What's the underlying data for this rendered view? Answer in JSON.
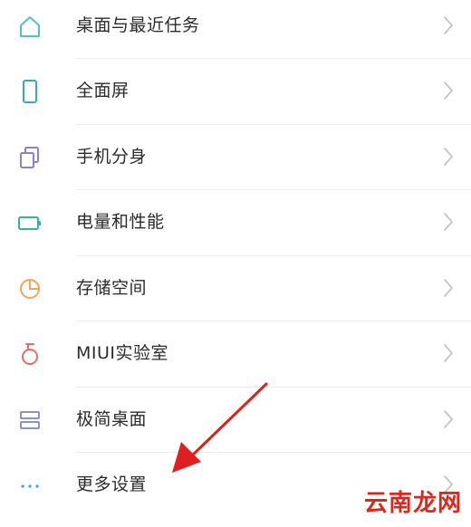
{
  "settings_list": [
    {
      "label": "桌面与最近任务",
      "icon": "home-icon",
      "icon_color": "#5bbfb5"
    },
    {
      "label": "全面屏",
      "icon": "phone-fullscreen-icon",
      "icon_color": "#3aa6c9"
    },
    {
      "label": "手机分身",
      "icon": "clone-icon",
      "icon_color": "#8f7fc4"
    },
    {
      "label": "电量和性能",
      "icon": "battery-icon",
      "icon_color": "#3bb09b"
    },
    {
      "label": "存储空间",
      "icon": "storage-pie-icon",
      "icon_color": "#f2a35e"
    },
    {
      "label": "MIUI实验室",
      "icon": "flask-icon",
      "icon_color": "#e86b6b"
    },
    {
      "label": "极简桌面",
      "icon": "simple-desktop-icon",
      "icon_color": "#8a93c9"
    },
    {
      "label": "更多设置",
      "icon": "more-dots-icon",
      "icon_color": "#3aa6c9"
    }
  ],
  "colors": {
    "text": "#2b2b2b",
    "chevron": "#c4c4c4",
    "divider": "#ececec",
    "annotation_arrow": "#e02020",
    "watermark": "#d8291f"
  },
  "watermark": {
    "text": "云南龙网"
  }
}
